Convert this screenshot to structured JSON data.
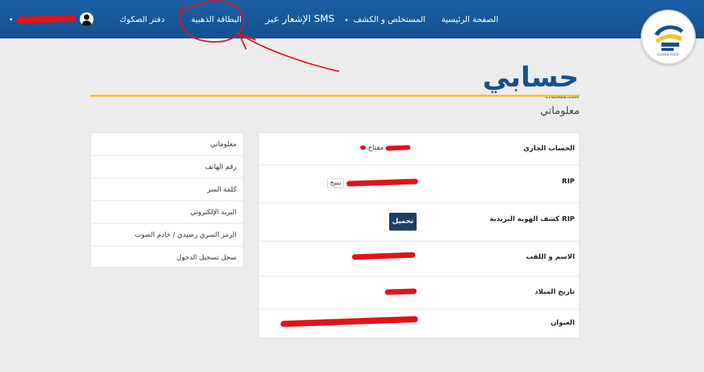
{
  "nav": {
    "home": "الصفحة الرئيسية",
    "statement": "المستخلص و الكشف",
    "sms": "الإشعار عبر SMS",
    "golden_card": "البطاقة الذهبية",
    "checkbook": "دفتر الصكوك",
    "caret": "▾",
    "user_caret": "▾"
  },
  "logo": {
    "text": "ALGERIE POSTE"
  },
  "page": {
    "title": "حسابي",
    "subtitle": "CYBERDZ.COM",
    "section_title": "معلوماتي"
  },
  "side_menu": [
    "معلوماتي",
    "رقم الهاتف",
    "كلمة السر",
    "البريد الإلكتروني",
    "الرمز السري رصيدي / خادم الصوت",
    "سجل تسجيل الدخول"
  ],
  "info": {
    "current_account_label": "الحساب الجاري",
    "current_account_key": "مفتاح",
    "rip_label": "RIP",
    "copy": "نسخ",
    "rip_statement_label": "كشف الهوية البريدية RIP",
    "download": "تحميل",
    "name_label": "الاسم و اللقب",
    "dob_label": "تاريخ الميلاد",
    "address_label": "العنوان"
  },
  "colors": {
    "nav_blue": "#14518f",
    "accent_yellow": "#f2c230",
    "redaction_red": "#e0141a",
    "button_navy": "#1d3f66"
  }
}
